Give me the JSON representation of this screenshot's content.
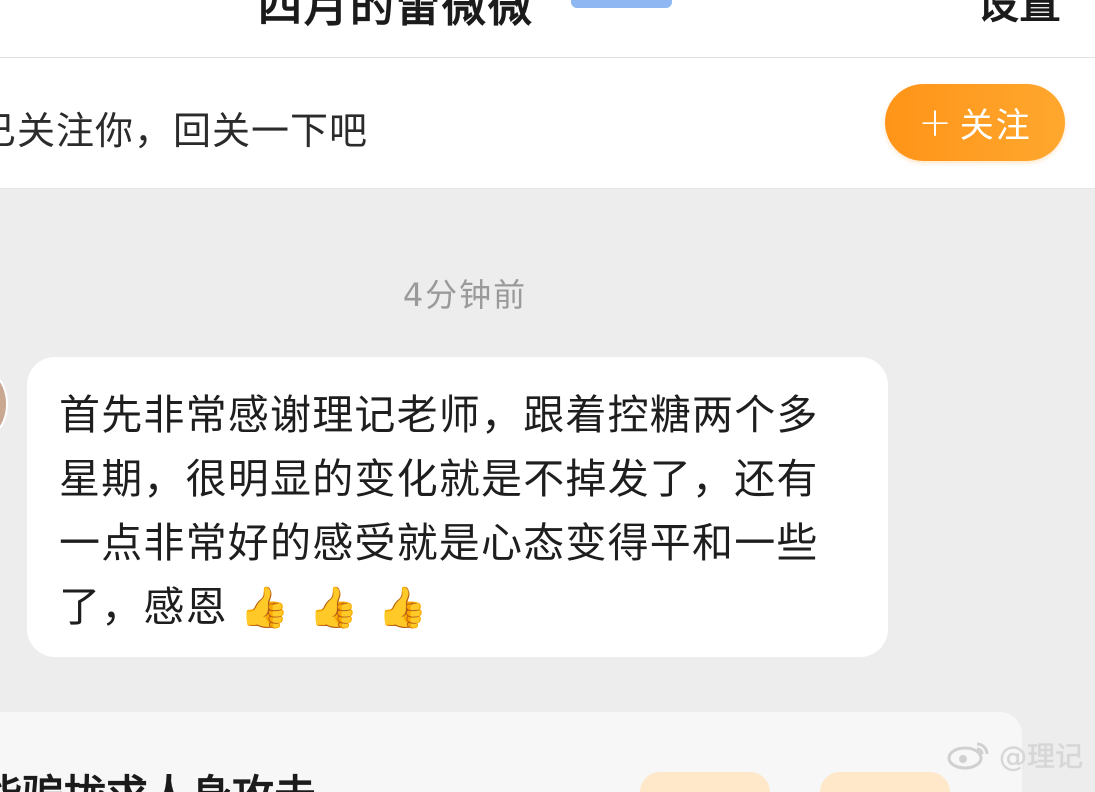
{
  "header": {
    "title": "四月的雷微微",
    "settings_label": "设置"
  },
  "follow_bar": {
    "text": "已关注你，回关一下吧",
    "button_plus": "+",
    "button_label": "关注"
  },
  "conversation": {
    "timestamp": "4分钟前",
    "message": "首先非常感谢理记老师，跟着控糖两个多星期，很明显的变化就是不掉发了，还有一点非常好的感受就是心态变得平和一些了，感恩",
    "emoji_thumbs": [
      "👍",
      "👍",
      "👍"
    ]
  },
  "bottom_card": {
    "title": "能骗拢求人身攻击"
  },
  "watermark": {
    "text": "@理记"
  },
  "colors": {
    "accent_orange": "#ff9418",
    "background": "#ededed"
  }
}
